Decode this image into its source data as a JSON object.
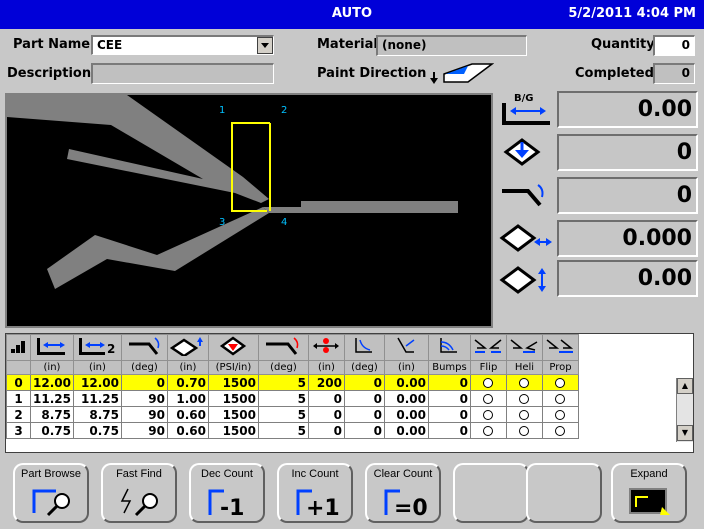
{
  "title": "AUTO",
  "datetime": "5/2/2011  4:04 PM",
  "header": {
    "part_name_label": "Part Name",
    "part_name_value": "CEE",
    "description_label": "Description",
    "description_value": "",
    "material_label": "Material",
    "material_value": "(none)",
    "paint_direction_label": "Paint Direction",
    "quantity_label": "Quantity",
    "quantity_value": "0",
    "completed_label": "Completed",
    "completed_value": "0"
  },
  "canvas": {
    "point_labels": [
      "1",
      "2",
      "3",
      "4"
    ],
    "colors": {
      "part": "#ffff00",
      "tooling": "#808080",
      "labels": "#00c0ff"
    }
  },
  "readouts": [
    {
      "icon": "backgauge-icon",
      "label": "B/G",
      "value": "0.00"
    },
    {
      "icon": "pressure-icon",
      "label": "",
      "value": "0"
    },
    {
      "icon": "angle-icon",
      "label": "",
      "value": "0"
    },
    {
      "icon": "radius-icon",
      "label": "",
      "value": "0.000"
    },
    {
      "icon": "height-icon",
      "label": "",
      "value": "0.00"
    }
  ],
  "grid": {
    "units": [
      "(in)",
      "(in)",
      "(deg)",
      "(in)",
      "(PSI/in)",
      "(deg)",
      "(in)",
      "(deg)",
      "(in)",
      "Bumps",
      "Flip",
      "Heli",
      "Prop"
    ],
    "rows": [
      {
        "idx": "0",
        "cells": [
          "12.00",
          "12.00",
          "0",
          "0.70",
          "1500",
          "5",
          "200",
          "0",
          "0.00",
          "0"
        ]
      },
      {
        "idx": "1",
        "cells": [
          "11.25",
          "11.25",
          "90",
          "1.00",
          "1500",
          "5",
          "0",
          "0",
          "0.00",
          "0"
        ]
      },
      {
        "idx": "2",
        "cells": [
          "8.75",
          "8.75",
          "90",
          "0.60",
          "1500",
          "5",
          "0",
          "0",
          "0.00",
          "0"
        ]
      },
      {
        "idx": "3",
        "cells": [
          "0.75",
          "0.75",
          "90",
          "0.60",
          "1500",
          "5",
          "0",
          "0",
          "0.00",
          "0"
        ]
      }
    ],
    "selected_row_color": "#ffff00"
  },
  "buttons": [
    {
      "label": "Part Browse",
      "icon": "part-browse-icon"
    },
    {
      "label": "Fast Find",
      "icon": "fast-find-icon"
    },
    {
      "label": "Dec Count",
      "icon": "dec-count-icon"
    },
    {
      "label": "Inc Count",
      "icon": "inc-count-icon"
    },
    {
      "label": "Clear Count",
      "icon": "clear-count-icon"
    },
    {
      "label": "",
      "icon": ""
    },
    {
      "label": "",
      "icon": ""
    },
    {
      "label": "Expand",
      "icon": "expand-icon"
    }
  ],
  "colors": {
    "titlebar": "#0000d8",
    "background": "#c8c8c8",
    "icon_blue": "#0040ff",
    "icon_red": "#ff0000"
  }
}
